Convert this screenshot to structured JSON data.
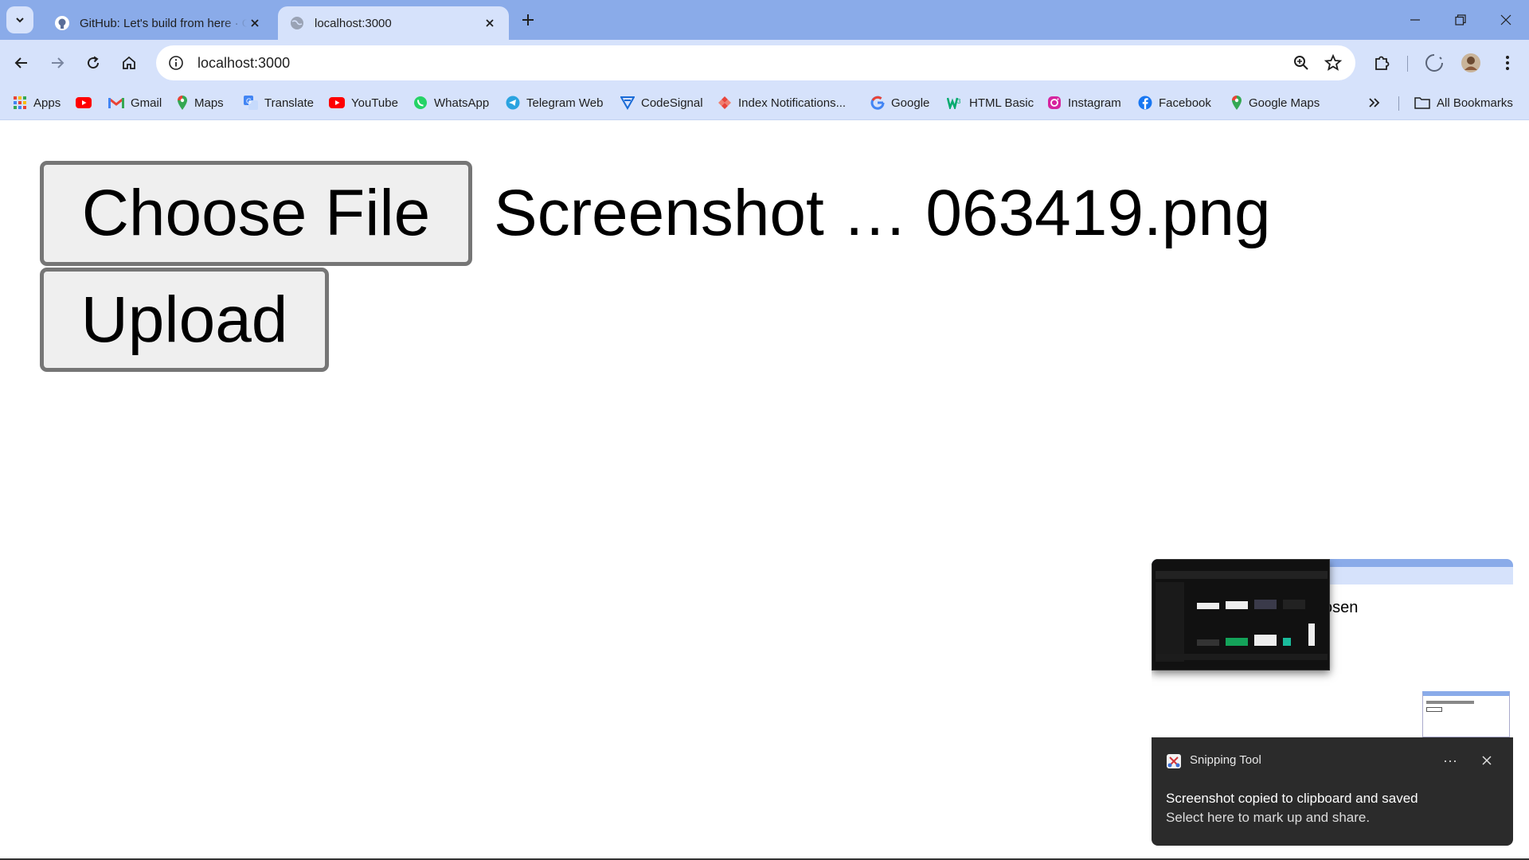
{
  "browser": {
    "tabs": [
      {
        "title": "GitHub: Let's build from here · GitHub",
        "icon": "github-icon",
        "active": false
      },
      {
        "title": "localhost:3000",
        "icon": "globe-icon",
        "active": true
      }
    ],
    "address": "localhost:3000",
    "colors": {
      "frame": "#8aabe9",
      "toolbar": "#d6e2fb"
    }
  },
  "bookmarks": {
    "items": [
      {
        "label": "Apps",
        "icon": "apps-grid-icon"
      },
      {
        "label": "",
        "icon": "youtube-icon"
      },
      {
        "label": "Gmail",
        "icon": "gmail-icon"
      },
      {
        "label": "Maps",
        "icon": "maps-pin-icon"
      },
      {
        "label": "Translate",
        "icon": "translate-icon"
      },
      {
        "label": "YouTube",
        "icon": "youtube-icon"
      },
      {
        "label": "WhatsApp",
        "icon": "whatsapp-icon"
      },
      {
        "label": "Telegram Web",
        "icon": "telegram-icon"
      },
      {
        "label": "CodeSignal",
        "icon": "codesignal-icon"
      },
      {
        "label": "Index Notifications...",
        "icon": "index-icon"
      },
      {
        "label": "Google",
        "icon": "google-icon"
      },
      {
        "label": "HTML Basic",
        "icon": "w3schools-icon"
      },
      {
        "label": "Instagram",
        "icon": "instagram-icon"
      },
      {
        "label": "Facebook",
        "icon": "facebook-icon"
      },
      {
        "label": "Google Maps",
        "icon": "maps-pin-icon"
      }
    ],
    "all_bookmarks": "All Bookmarks"
  },
  "page": {
    "choose_file_label": "Choose File",
    "chosen_file": "Screenshot … 063419.png",
    "upload_label": "Upload"
  },
  "toast": {
    "app_name": "Snipping Tool",
    "line1": "Screenshot copied to clipboard and saved",
    "line2": "Select here to mark up and share.",
    "preview_text": "osen",
    "more": "···"
  }
}
